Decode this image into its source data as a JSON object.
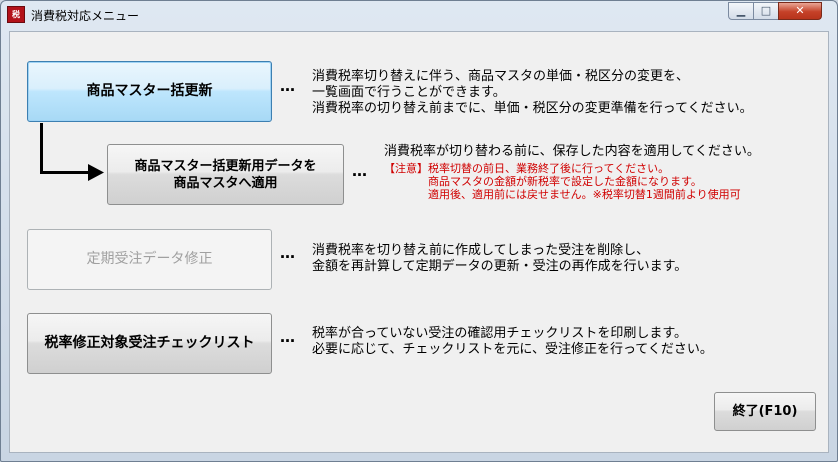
{
  "window": {
    "title": "消費税対応メニュー",
    "icon_name": "app-logo-icon",
    "minimize_icon": "minimize-icon",
    "maximize_icon": "maximize-icon",
    "close_icon": "close-icon",
    "glyphs": {
      "minimize": "▁",
      "maximize": "□",
      "close": "✕"
    }
  },
  "menu": {
    "bulk_update": {
      "label": "商品マスター括更新",
      "dots": "…",
      "desc_line1": "消費税率切り替えに伴う、商品マスタの単価・税区分の変更を、",
      "desc_line2": "一覧画面で行うことができます。",
      "desc_line3": "消費税率の切り替え前までに、単価・税区分の変更準備を行ってください。"
    },
    "apply_update": {
      "label_line1": "商品マスター括更新用データを",
      "label_line2": "商品マスタへ適用",
      "dots": "…",
      "desc_line1": "消費税率が切り替わる前に、保存した内容を適用してください。",
      "note_line1": "【注意】税率切替の前日、業務終了後に行ってください。",
      "note_line2": "商品マスタの金額が新税率で設定した金額になります。",
      "note_line3": "適用後、適用前には戻せません。※税率切替1週間前より使用可"
    },
    "recurring_fix": {
      "label": "定期受注データ修正",
      "dots": "…",
      "desc_line1": "消費税率を切り替え前に作成してしまった受注を削除し、",
      "desc_line2": "金額を再計算して定期データの更新・受注の再作成を行います。"
    },
    "checklist": {
      "label": "税率修正対象受注チェックリスト",
      "dots": "…",
      "desc_line1": "税率が合っていない受注の確認用チェックリストを印刷します。",
      "desc_line2": "必要に応じて、チェックリストを元に、受注修正を行ってください。"
    }
  },
  "footer": {
    "exit_label": "終了(F10)"
  },
  "colors": {
    "note_red": "#d00000",
    "focus_blue": "#3c7fb1"
  }
}
